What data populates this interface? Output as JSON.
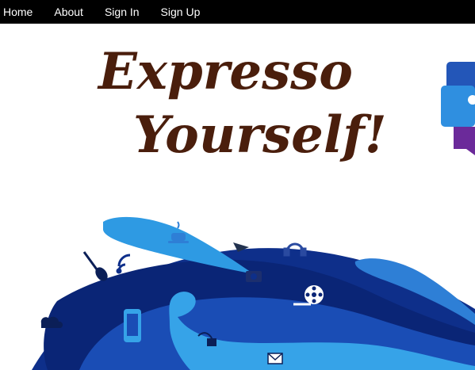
{
  "nav": {
    "items": [
      {
        "label": "Home"
      },
      {
        "label": "About"
      },
      {
        "label": "Sign In"
      },
      {
        "label": "Sign Up"
      }
    ]
  },
  "hero": {
    "line1": "Expresso",
    "line2": "Yourself!"
  },
  "colors": {
    "title": "#4a1e0c",
    "wave_dark": "#0e2f8a",
    "wave_mid": "#1a4db5",
    "wave_light": "#2e9ae3",
    "wave_sky": "#36a3e8",
    "icons": "#22324f"
  }
}
